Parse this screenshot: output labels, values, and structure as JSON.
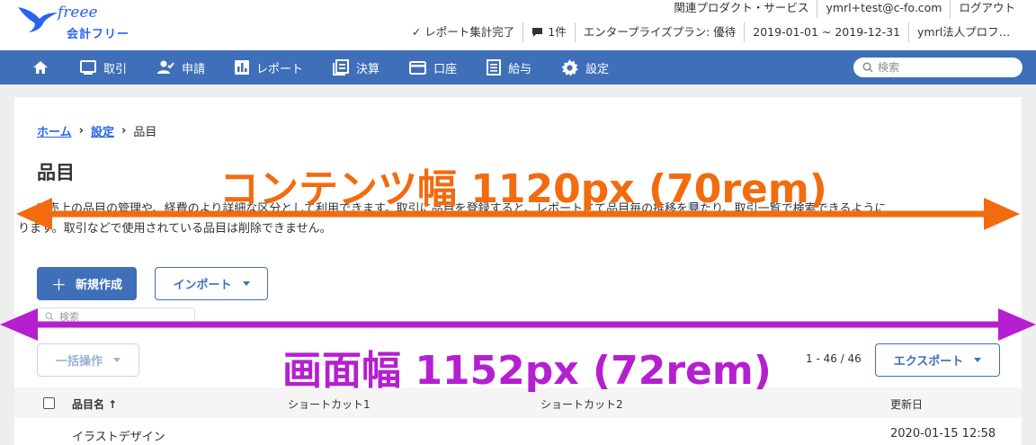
{
  "header": {
    "logo_script": "freee",
    "logo_product": "会計フリー",
    "links": {
      "related": "関連プロダクト・サービス",
      "user": "ymrl+test@c-fo.com",
      "logout": "ログアウト"
    },
    "status": {
      "report_done": "✓ レポート集計完了",
      "notifications": "1件",
      "plan": "エンタープライズプラン: 優待",
      "period": "2019-01-01 ~ 2019-12-31",
      "company": "ymrl法人プロフェッ..."
    }
  },
  "nav": {
    "items": [
      {
        "label": ""
      },
      {
        "label": "取引"
      },
      {
        "label": "申請"
      },
      {
        "label": "レポート"
      },
      {
        "label": "決算"
      },
      {
        "label": "口座"
      },
      {
        "label": "給与"
      },
      {
        "label": "設定"
      }
    ],
    "search_placeholder": "検索"
  },
  "breadcrumb": {
    "home": "ホーム",
    "settings": "設定",
    "current": "品目"
  },
  "page": {
    "title": "品目",
    "description_1a": "は売上の品目の管理や、経費のより詳細な区分として利用できます。取引に品目を登録すると、レポートにて品目毎の推移を",
    "description_1b": "見",
    "description_1c": "たり、取引一覧で検索できるように",
    "description_2": "ります。取引などで使用されている品目は削除できません。"
  },
  "actions": {
    "new": "新規作成",
    "import": "インポート",
    "filter_placeholder": "検索",
    "bulk": "一括操作",
    "pager": "1 - 46 / 46",
    "export": "エクスポート"
  },
  "table": {
    "columns": [
      "品目名 ↑",
      "ショートカット1",
      "ショートカット2",
      "更新日"
    ],
    "rows": [
      {
        "name": "イラストデザイン",
        "shortcut1": "",
        "shortcut2": "",
        "updated": "2020-01-15 12:58"
      }
    ]
  },
  "annotations": {
    "content_width": "コンテンツ幅 1120px (70rem)",
    "screen_width": "画面幅 1152px (72rem)",
    "content_color": "#f26b0f",
    "screen_color": "#b51fd0"
  }
}
